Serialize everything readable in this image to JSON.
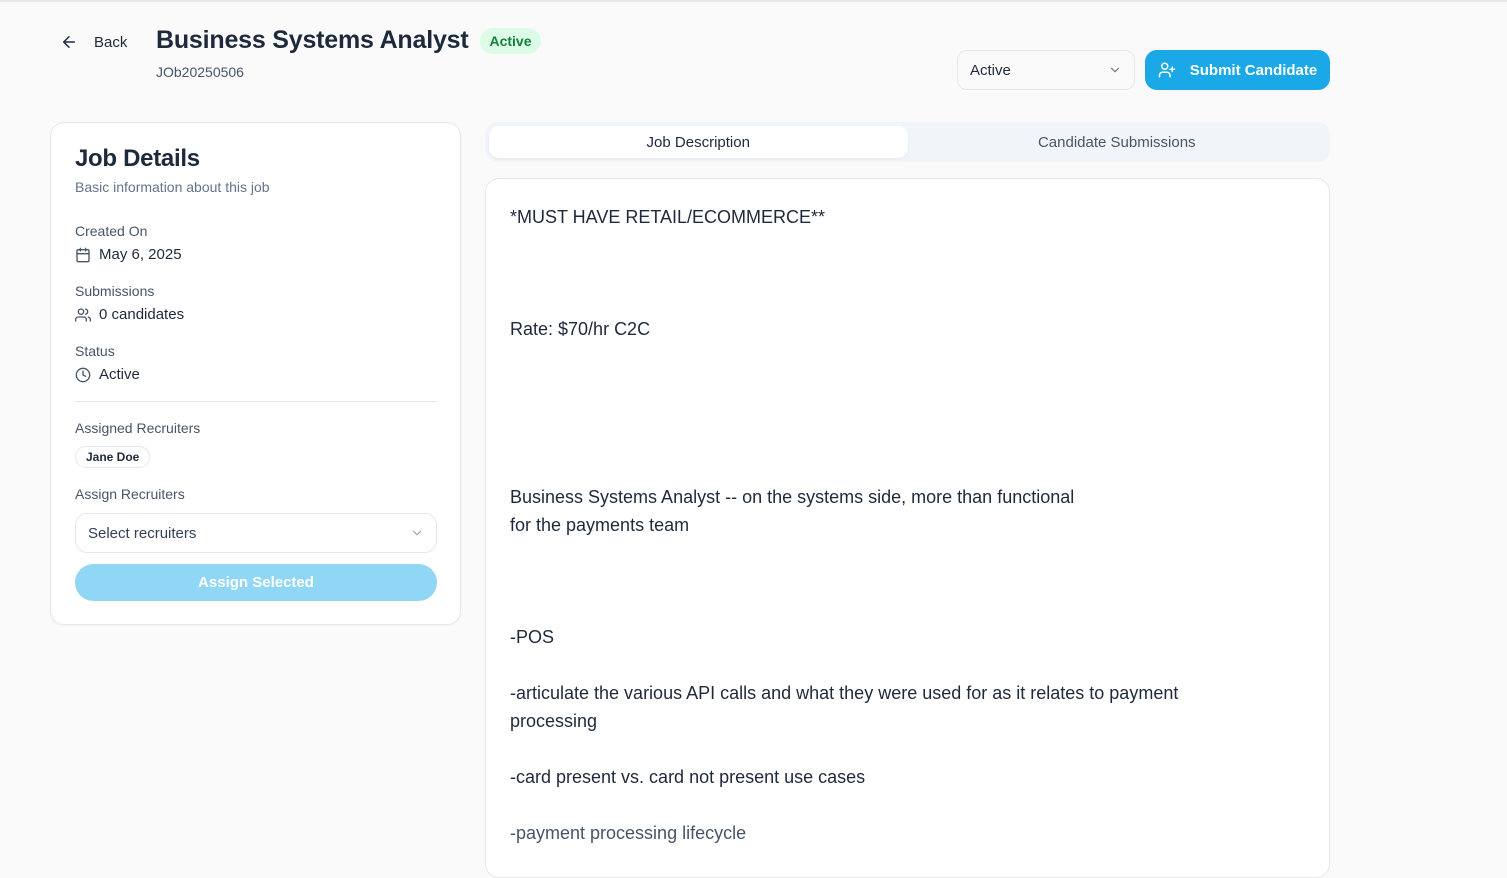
{
  "header": {
    "back_label": "Back",
    "title": "Business Systems Analyst",
    "status_badge": "Active",
    "job_id": "JOb20250506",
    "status_select_value": "Active",
    "submit_label": "Submit Candidate"
  },
  "job_details": {
    "title": "Job Details",
    "subtitle": "Basic information about this job",
    "created_on_label": "Created On",
    "created_on_value": "May 6, 2025",
    "submissions_label": "Submissions",
    "submissions_value": "0 candidates",
    "status_label": "Status",
    "status_value": "Active",
    "assigned_recruiters_label": "Assigned Recruiters",
    "assigned_recruiters": [
      "Jane Doe"
    ],
    "assign_recruiters_label": "Assign Recruiters",
    "recruiter_select_placeholder": "Select recruiters",
    "assign_button_label": "Assign Selected"
  },
  "tabs": [
    {
      "label": "Job Description",
      "active": true
    },
    {
      "label": "Candidate Submissions",
      "active": false
    }
  ],
  "description": {
    "line1": "*MUST HAVE RETAIL/ECOMMERCE**",
    "line2": "Rate: $70/hr C2C",
    "line3": "Business Systems Analyst -- on the systems side, more than functional",
    "line4": "for the payments team",
    "line5": "-POS",
    "line6": "-articulate the various API calls and what they were used for as it relates to payment",
    "line7": "processing",
    "line8": "-card present vs. card not present use cases",
    "line9": "-payment processing lifecycle"
  },
  "colors": {
    "primary": "#1ba8e6",
    "primary_disabled": "#8fd7f5",
    "badge_bg": "#dcfce7",
    "badge_text": "#15803d"
  },
  "icons": {
    "back": "arrow-left-icon",
    "submit": "user-plus-icon",
    "created_on": "calendar-icon",
    "submissions": "users-icon",
    "status": "clock-icon",
    "select": "chevron-down-icon"
  }
}
